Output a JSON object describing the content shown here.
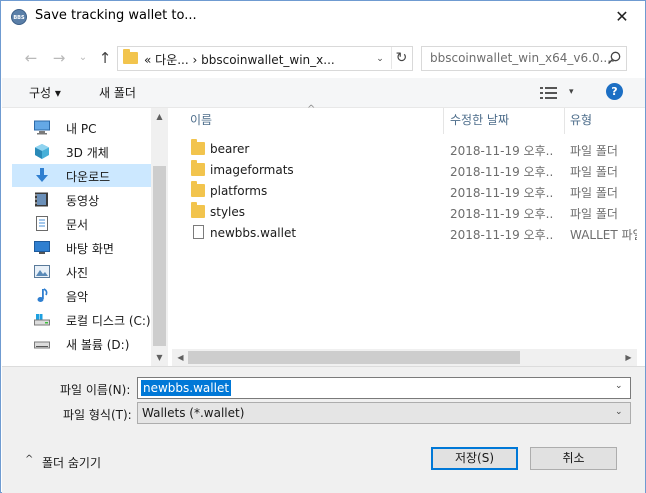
{
  "window": {
    "app_icon_label": "BBS",
    "title": "Save tracking wallet to...",
    "close_glyph": "✕"
  },
  "nav": {
    "back_glyph": "←",
    "forward_glyph": "→",
    "history_glyph": "⌄",
    "up_glyph": "↑",
    "address": "«  다운...  ›  bbscoinwallet_win_x...",
    "address_drop_glyph": "⌄",
    "refresh_glyph": "↻",
    "search_placeholder": "bbscoinwallet_win_x64_v6.0....",
    "search_icon_glyph": "⚲"
  },
  "commands": {
    "organize": "구성 ▾",
    "new_folder": "새 폴더",
    "view_glyph": "☷",
    "view_drop_glyph": "▾",
    "help_glyph": "?"
  },
  "sidebar": {
    "items": [
      {
        "label": "내 PC",
        "icon": "pc-icon",
        "selected": false
      },
      {
        "label": "3D 개체",
        "icon": "cube-icon",
        "selected": false
      },
      {
        "label": "다운로드",
        "icon": "download-icon",
        "selected": true
      },
      {
        "label": "동영상",
        "icon": "video-icon",
        "selected": false
      },
      {
        "label": "문서",
        "icon": "document-icon",
        "selected": false
      },
      {
        "label": "바탕 화면",
        "icon": "desktop-icon",
        "selected": false
      },
      {
        "label": "사진",
        "icon": "picture-icon",
        "selected": false
      },
      {
        "label": "음악",
        "icon": "music-icon",
        "selected": false
      },
      {
        "label": "로컬 디스크 (C:)",
        "icon": "drive-icon",
        "selected": false
      },
      {
        "label": "새 볼륨 (D:)",
        "icon": "drive-icon",
        "selected": false
      }
    ],
    "scroll_up_glyph": "▲",
    "scroll_down_glyph": "▼"
  },
  "file_list": {
    "columns": {
      "name": "이름",
      "modified": "수정한 날짜",
      "type": "유형"
    },
    "sort_glyph": "^",
    "rows": [
      {
        "name": "bearer",
        "modified": "2018-11-19 오후...",
        "type": "파일 폴더",
        "kind": "folder"
      },
      {
        "name": "imageformats",
        "modified": "2018-11-19 오후...",
        "type": "파일 폴더",
        "kind": "folder"
      },
      {
        "name": "platforms",
        "modified": "2018-11-19 오후...",
        "type": "파일 폴더",
        "kind": "folder"
      },
      {
        "name": "styles",
        "modified": "2018-11-19 오후...",
        "type": "파일 폴더",
        "kind": "folder"
      },
      {
        "name": "newbbs.wallet",
        "modified": "2018-11-19 오후...",
        "type": "WALLET 파일",
        "kind": "file"
      }
    ],
    "hscroll_left_glyph": "◀",
    "hscroll_right_glyph": "▶"
  },
  "form": {
    "filename_label": "파일 이름(N):",
    "filename_value": "newbbs.wallet",
    "filetype_label": "파일 형식(T):",
    "filetype_value": "Wallets (*.wallet)",
    "drop_glyph": "⌄"
  },
  "footer": {
    "hide_folders_caret": "^",
    "hide_folders": "폴더 숨기기",
    "save": "저장(S)",
    "cancel": "취소"
  },
  "colors": {
    "selection": "#cce8ff",
    "accent": "#0078d7",
    "folder": "#f2c44d"
  }
}
